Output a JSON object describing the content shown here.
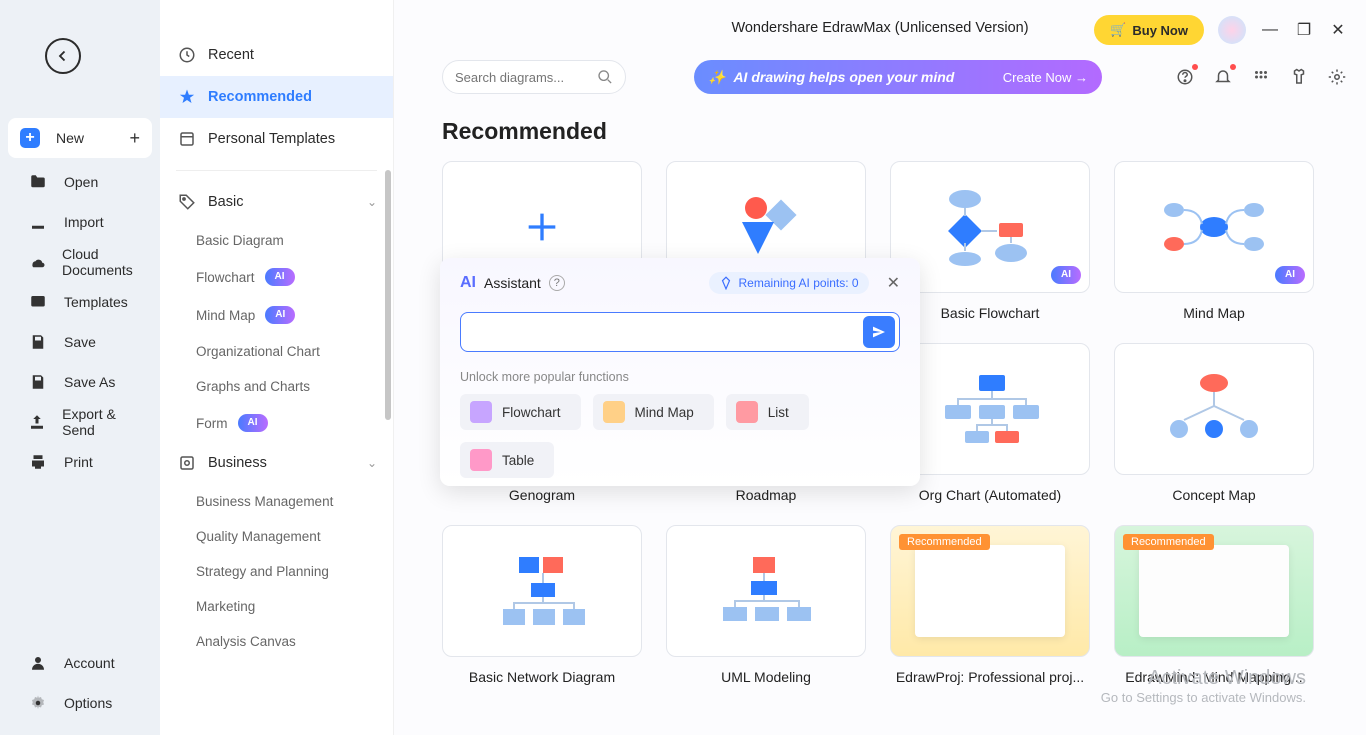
{
  "app_title": "Wondershare EdrawMax (Unlicensed Version)",
  "left": {
    "new": "New",
    "open": "Open",
    "import": "Import",
    "cloud": "Cloud Documents",
    "templates": "Templates",
    "save": "Save",
    "saveas": "Save As",
    "export": "Export & Send",
    "print": "Print",
    "account": "Account",
    "options": "Options"
  },
  "mid": {
    "recent": "Recent",
    "recommended": "Recommended",
    "personal": "Personal Templates",
    "basic_h": "Basic",
    "business_h": "Business",
    "basic": {
      "diagram": "Basic Diagram",
      "flowchart": "Flowchart",
      "mindmap": "Mind Map",
      "org": "Organizational Chart",
      "graphs": "Graphs and Charts",
      "form": "Form"
    },
    "business": {
      "bm": "Business Management",
      "qm": "Quality Management",
      "sp": "Strategy and Planning",
      "mk": "Marketing",
      "ac": "Analysis Canvas"
    }
  },
  "ai_badge": "AI",
  "search_ph": "Search diagrams...",
  "ai_banner": {
    "text": "AI drawing helps open your mind",
    "create": "Create Now →"
  },
  "buy": "Buy Now",
  "heading": "Recommended",
  "cards": {
    "blank": "",
    "flowchart": "Basic Flowchart",
    "mindmap": "Mind Map",
    "genogram": "Genogram",
    "roadmap": "Roadmap",
    "orgchart": "Org Chart (Automated)",
    "concept": "Concept Map",
    "network": "Basic Network Diagram",
    "uml": "UML Modeling",
    "proj": "EdrawProj: Professional proj...",
    "mind": "EdrawMind: Mind Mapping..."
  },
  "rec_label": "Recommended",
  "assistant": {
    "title": "Assistant",
    "points": "Remaining AI points: 0",
    "unlock": "Unlock more popular functions",
    "funcs": {
      "fc": "Flowchart",
      "mm": "Mind Map",
      "li": "List",
      "tb": "Table"
    }
  },
  "watermark": {
    "l1": "Activate Windows",
    "l2": "Go to Settings to activate Windows."
  }
}
